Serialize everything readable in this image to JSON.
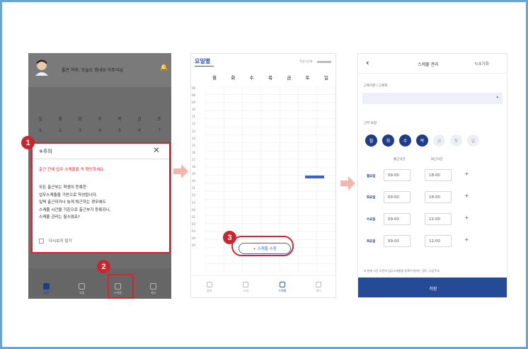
{
  "screen1": {
    "greeting": "좋은 하루, 오늘도 힘내요 이주석님",
    "weekdays": [
      "일",
      "월",
      "화",
      "수",
      "목",
      "금",
      "토"
    ],
    "dates": [
      "1",
      "2",
      "3",
      "4",
      "5",
      "6",
      "7"
    ],
    "modal": {
      "title": "※주의",
      "close": "✕",
      "warning": "출근 전에 업무 스케줄을 꼭 확인하세요.",
      "body_lines": [
        "모든 출근부는 학생이 등록한",
        "업무스케줄을 기반으로 작성됩니다.",
        "일찍 출근하거나 늦게 퇴근하는 경우에도",
        "스케줄 시간을 기준으로 출근부가 등록되니,",
        "스케줄 관리는 필수였죠?"
      ],
      "checkbox_label": "다시보지 않기"
    },
    "nav": [
      "출퇴",
      "요청",
      "스케줄",
      "메시"
    ]
  },
  "screen2": {
    "title": "요일별",
    "status": "작업시간대",
    "days": [
      "월",
      "화",
      "수",
      "목",
      "금",
      "토",
      "일"
    ],
    "hours": [
      "06",
      "08",
      "09",
      "10",
      "11",
      "12",
      "13",
      "14",
      "15",
      "16",
      "17",
      "18",
      "19",
      "20",
      "21",
      "22",
      "23",
      "00",
      "01",
      "02",
      "03",
      "04",
      "05"
    ],
    "edit_button": "+ 스케줄 수정",
    "nav": [
      "출퇴",
      "요청",
      "스케줄",
      "메시"
    ]
  },
  "screen3": {
    "back": "‹",
    "title": "스케줄 관리",
    "reset": "↻초기화",
    "org_label": "근로기관 / 근로처",
    "caret": "▴",
    "work_days_label": "근무 요일",
    "day_chips": [
      {
        "label": "월",
        "on": true
      },
      {
        "label": "화",
        "on": true
      },
      {
        "label": "수",
        "on": true
      },
      {
        "label": "목",
        "on": true
      },
      {
        "label": "금",
        "on": false
      },
      {
        "label": "토",
        "on": false
      },
      {
        "label": "일",
        "on": false
      }
    ],
    "start_label": "출근시간",
    "end_label": "퇴근시간",
    "rows": [
      {
        "day": "월요일",
        "start": "09:00",
        "end": "18:00"
      },
      {
        "day": "화요일",
        "start": "09:00",
        "end": "18:00"
      },
      {
        "day": "수요일",
        "start": "09:00",
        "end": "12:00"
      },
      {
        "day": "목요일",
        "start": "09:00",
        "end": "12:00"
      }
    ],
    "plus": "+",
    "note": "※ 현재 시간 이전의 업무스케줄을 등록/수정하는 경우, 다음주부",
    "save": "저장"
  },
  "steps": [
    "1",
    "2",
    "3"
  ],
  "colors": {
    "accent": "#1e3c8a",
    "highlight": "#d8242e",
    "frame": "#6aa5cf",
    "arrow": "#f2b7aa"
  }
}
